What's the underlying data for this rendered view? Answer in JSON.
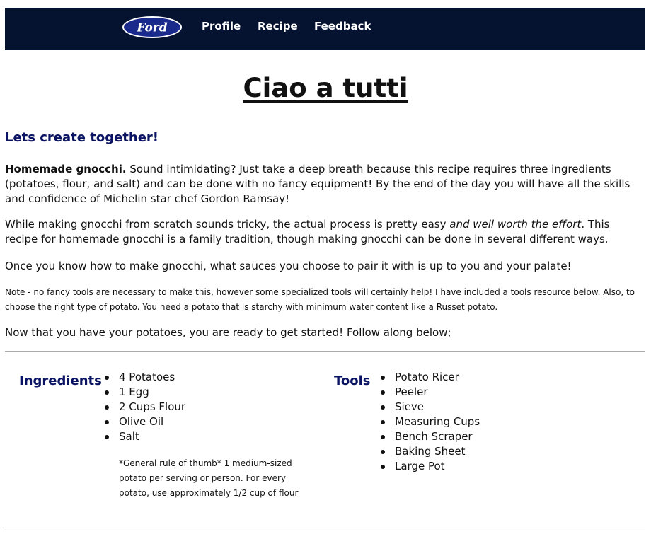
{
  "nav": {
    "logo_text": "Ford",
    "links": [
      "Profile",
      "Recipe",
      "Feedback"
    ]
  },
  "main": {
    "title": "Ciao a tutti",
    "subtitle": "Lets create together!",
    "p1_bold": "Homemade gnocchi.",
    "p1_text": " Sound intimidating? Just take a deep breath because this recipe requires three ingredients (potatoes, flour, and salt) and can be done with no fancy equipment! By the end of the day you will have all the skills and confidence of Michelin star chef Gordon Ramsay!",
    "p2_a": "While making gnocchi from scratch sounds tricky, the actual process is pretty easy ",
    "p2_em": "and well worth the effort",
    "p2_b": ". This recipe for homemade gnocchi is a family tradition, though making gnocchi can be done in several different ways.",
    "p3": "Once you know how to make gnocchi, what sauces you choose to pair it with is up to you and your palate!",
    "note": "Note - no fancy tools are necessary to make this, however some specialized tools will certainly help! I have included a tools resource below. Also, to choose the right type of potato. You need a potato that is starchy with minimum water content like a Russet potato.",
    "p4": "Now that you have your potatoes, you are ready to get started! Follow along below;"
  },
  "ingredients": {
    "heading": "Ingredients",
    "items": [
      "4 Potatoes",
      "1 Egg",
      "2 Cups Flour",
      "Olive Oil",
      "Salt"
    ],
    "tip": "*General rule of thumb* 1 medium-sized potato per serving or person. For every potato, use approximately 1/2 cup of flour"
  },
  "tools": {
    "heading": "Tools",
    "items": [
      "Potato Ricer",
      "Peeler",
      "Sieve",
      "Measuring Cups",
      "Bench Scraper",
      "Baking Sheet",
      "Large Pot"
    ]
  },
  "colors": {
    "nav_bg": "#051330",
    "heading_blue": "#0a1463",
    "logo_blue": "#1a2a8c"
  }
}
